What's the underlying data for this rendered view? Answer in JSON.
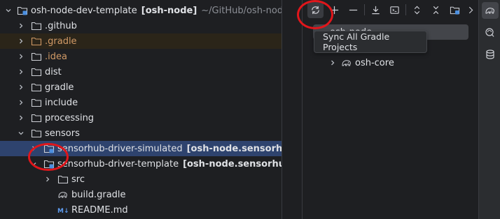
{
  "project_tree": {
    "root": {
      "name": "osh-node-dev-template",
      "module": "[osh-node]",
      "path": "~/GitHub/osh-node"
    },
    "items": [
      {
        "label": "osh-node-dev-template",
        "module": "[osh-node]",
        "path": "~/GitHub/osh-node",
        "kind": "module-root",
        "icon": "module-folder-icon",
        "expanded": true
      },
      {
        "label": ".github",
        "kind": "folder",
        "icon": "folder-icon",
        "expanded": false
      },
      {
        "label": ".gradle",
        "kind": "excluded-folder",
        "icon": "excluded-folder-icon",
        "expanded": false
      },
      {
        "label": ".idea",
        "kind": "excluded-folder",
        "icon": "folder-icon",
        "expanded": false
      },
      {
        "label": "dist",
        "kind": "folder",
        "icon": "folder-icon",
        "expanded": false
      },
      {
        "label": "gradle",
        "kind": "folder",
        "icon": "folder-icon",
        "expanded": false
      },
      {
        "label": "include",
        "kind": "folder",
        "icon": "folder-icon",
        "expanded": false
      },
      {
        "label": "processing",
        "kind": "folder",
        "icon": "folder-icon",
        "expanded": false
      },
      {
        "label": "sensors",
        "kind": "folder",
        "icon": "folder-icon",
        "expanded": true
      },
      {
        "label": "sensorhub-driver-simulated",
        "module": "[osh-node.sensorhub",
        "kind": "module",
        "icon": "module-folder-icon",
        "expanded": false,
        "selected": true
      },
      {
        "label": "sensorhub-driver-template",
        "module": "[osh-node.sensorhub-",
        "kind": "module",
        "icon": "module-folder-icon",
        "expanded": true
      },
      {
        "label": "src",
        "kind": "folder",
        "icon": "folder-icon",
        "expanded": false
      },
      {
        "label": "build.gradle",
        "kind": "file",
        "icon": "gradle-elephant-icon"
      },
      {
        "label": "README.md",
        "kind": "file",
        "icon": "markdown-icon"
      }
    ]
  },
  "gradle_panel": {
    "toolbar": [
      {
        "name": "sync-all-icon",
        "active": true
      },
      {
        "name": "add-icon"
      },
      {
        "name": "remove-icon"
      },
      {
        "name": "download-icon"
      },
      {
        "name": "run-task-icon"
      },
      {
        "name": "expand-all-icon"
      },
      {
        "name": "collapse-all-icon"
      },
      {
        "name": "module-settings-icon"
      },
      {
        "name": "more-chevron-icon"
      }
    ],
    "tree": [
      {
        "label": "osh-node",
        "selected": true
      },
      {
        "label": "osh-core",
        "expanded": false
      }
    ],
    "tooltip": "Sync All Gradle Projects"
  },
  "right_strip": [
    {
      "name": "gradle-tool-icon",
      "active": true
    },
    {
      "name": "ai-assistant-icon"
    },
    {
      "name": "database-icon"
    }
  ],
  "colors": {
    "background": "#1e1f22",
    "selection": "#2e436e",
    "excluded_row": "#2b2519",
    "excluded_text": "#d19a66",
    "annotation": "#e0161b",
    "module_icon_blue": "#4b8fe0"
  }
}
